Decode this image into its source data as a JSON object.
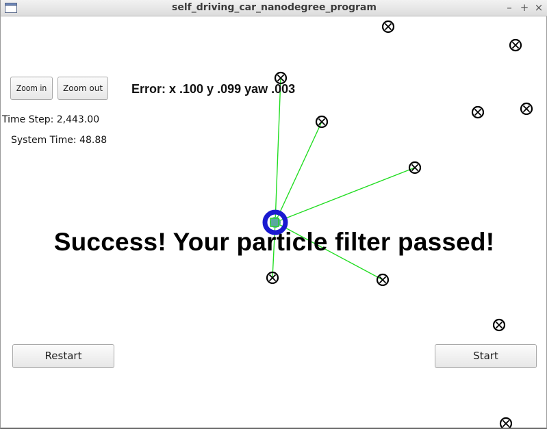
{
  "window": {
    "title": "self_driving_car_nanodegree_program",
    "minimize_glyph": "–",
    "maximize_glyph": "+",
    "close_glyph": "×"
  },
  "controls": {
    "zoom_in_label": "Zoom in",
    "zoom_out_label": "Zoom out",
    "restart_label": "Restart",
    "start_label": "Start"
  },
  "status": {
    "time_step": "Time Step: 2,443.00",
    "system_time": "System Time: 48.88"
  },
  "error_readout": "Error: x .100 y .099 yaw .003",
  "message": "Success! Your particle filter passed!",
  "colors": {
    "observation_line": "#22dd22",
    "vehicle": "#1a1ad0",
    "landmark": "#000000"
  },
  "icons": {
    "landmark": "circled-x-icon",
    "vehicle": "car-marker-icon",
    "app": "window-icon"
  }
}
